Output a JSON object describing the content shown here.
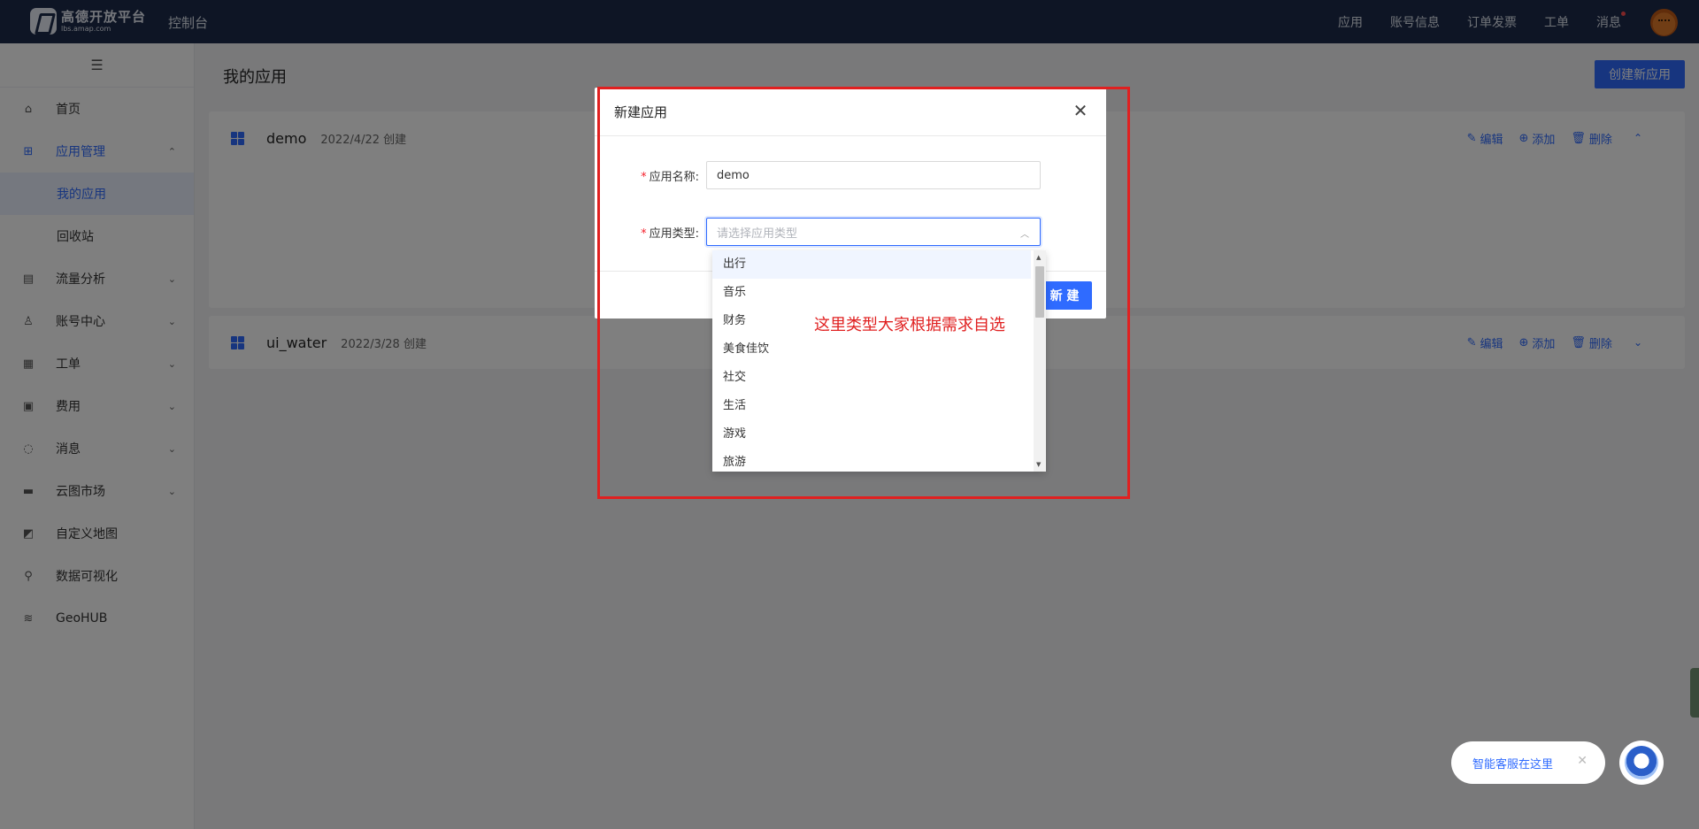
{
  "topbar": {
    "logo_cn": "高德开放平台",
    "logo_en": "lbs.amap.com",
    "console": "控制台",
    "nav": [
      "应用",
      "账号信息",
      "订单发票",
      "工单",
      "消息"
    ]
  },
  "sidebar": {
    "items": [
      {
        "label": "首页",
        "icon": "home-icon"
      },
      {
        "label": "应用管理",
        "icon": "apps-icon"
      },
      {
        "label": "我的应用"
      },
      {
        "label": "回收站"
      },
      {
        "label": "流量分析",
        "icon": "chart-icon"
      },
      {
        "label": "账号中心",
        "icon": "user-icon"
      },
      {
        "label": "工单",
        "icon": "ticket-icon"
      },
      {
        "label": "费用",
        "icon": "fee-icon"
      },
      {
        "label": "消息",
        "icon": "message-icon"
      },
      {
        "label": "云图市场",
        "icon": "store-icon"
      },
      {
        "label": "自定义地图",
        "icon": "map-icon"
      },
      {
        "label": "数据可视化",
        "icon": "visual-icon"
      },
      {
        "label": "GeoHUB",
        "icon": "layers-icon"
      }
    ]
  },
  "main": {
    "title": "我的应用",
    "create_button": "创建新应用",
    "apps": [
      {
        "name": "demo",
        "date": "2022/4/22 创建"
      },
      {
        "name": "ui_water",
        "date": "2022/3/28 创建"
      }
    ],
    "actions": {
      "edit": "编辑",
      "add": "添加",
      "delete": "删除"
    }
  },
  "modal": {
    "title": "新建应用",
    "name_label": "应用名称:",
    "name_value": "demo",
    "type_label": "应用类型:",
    "type_placeholder": "请选择应用类型",
    "submit": "新 建",
    "options": [
      "出行",
      "音乐",
      "财务",
      "美食佳饮",
      "社交",
      "生活",
      "游戏",
      "旅游"
    ]
  },
  "annotation": "这里类型大家根据需求自选",
  "assistant": {
    "label": "智能客服在这里"
  },
  "colors": {
    "topbar": "#1c2a4a",
    "accent": "#2f6bff",
    "annotation_red": "#e02020"
  }
}
